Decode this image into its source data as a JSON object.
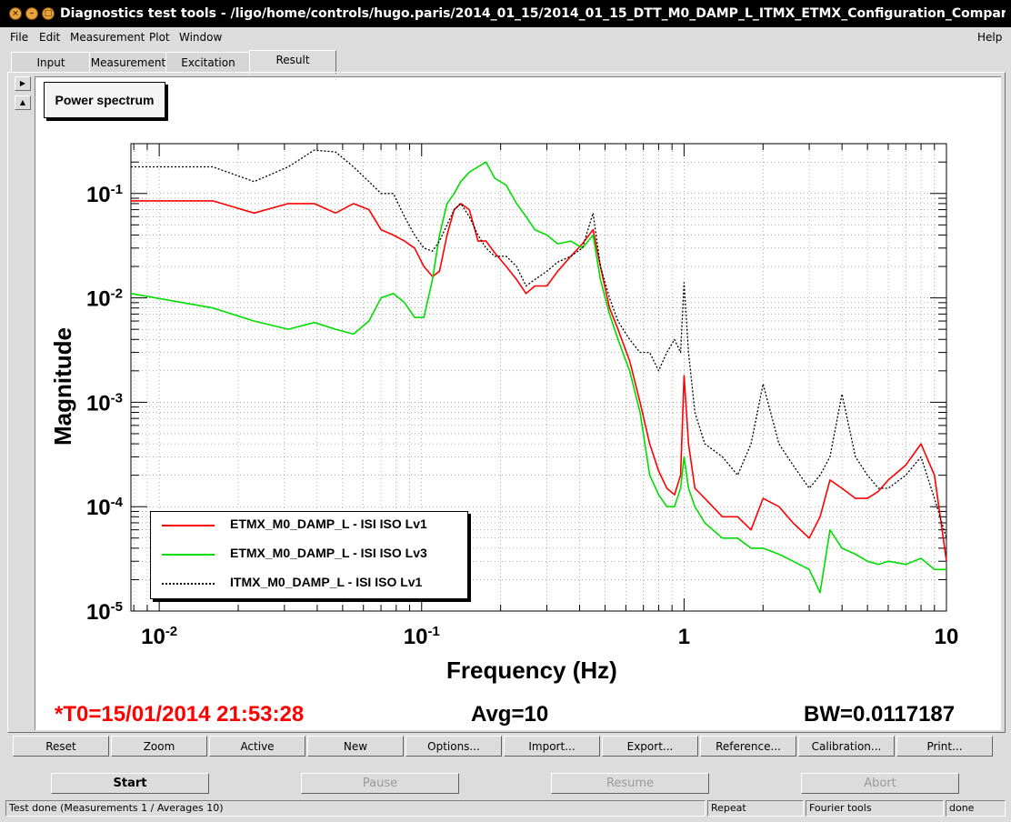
{
  "window": {
    "title": "Diagnostics test tools - /ligo/home/controls/hugo.paris/2014_01_15/2014_01_15_DTT_M0_DAMP_L_ITMX_ETMX_Configuration_Comparison_Adjus",
    "buttons": [
      "close-icon",
      "minimize-icon",
      "maximize-icon"
    ]
  },
  "menu": {
    "file": "File",
    "edit": "Edit",
    "measurement": "Measurement",
    "plot": "Plot",
    "window": "Window",
    "help": "Help"
  },
  "tabs": [
    {
      "label": "Input"
    },
    {
      "label": "Measurement"
    },
    {
      "label": "Excitation"
    },
    {
      "label": "Result"
    }
  ],
  "plot_panel": {
    "label": "Power spectrum"
  },
  "info": {
    "t0": "*T0=15/01/2014 21:53:28",
    "avg": "Avg=10",
    "bw": "BW=0.0117187"
  },
  "chart_data": {
    "type": "line",
    "xlabel": "Frequency (Hz)",
    "ylabel": "Magnitude",
    "xscale": "log",
    "yscale": "log",
    "xlim": [
      0.0078,
      10
    ],
    "ylim": [
      1e-05,
      0.3
    ],
    "x_ticks": [
      "10-2",
      "10-1",
      "1",
      "10"
    ],
    "y_ticks": [
      "10-1",
      "10-2",
      "10-3",
      "10-4",
      "10-5"
    ],
    "grid": true,
    "legend_position": "bottom-left",
    "series": [
      {
        "name": "ETMX_M0_DAMP_L - ISI ISO Lv1",
        "color": "#ff0000",
        "style": "solid",
        "points": [
          [
            0.0078,
            0.085
          ],
          [
            0.016,
            0.085
          ],
          [
            0.023,
            0.065
          ],
          [
            0.031,
            0.08
          ],
          [
            0.039,
            0.08
          ],
          [
            0.047,
            0.065
          ],
          [
            0.055,
            0.08
          ],
          [
            0.063,
            0.07
          ],
          [
            0.07,
            0.045
          ],
          [
            0.078,
            0.04
          ],
          [
            0.086,
            0.035
          ],
          [
            0.094,
            0.03
          ],
          [
            0.102,
            0.02
          ],
          [
            0.11,
            0.016
          ],
          [
            0.117,
            0.018
          ],
          [
            0.125,
            0.04
          ],
          [
            0.133,
            0.07
          ],
          [
            0.141,
            0.08
          ],
          [
            0.152,
            0.07
          ],
          [
            0.164,
            0.035
          ],
          [
            0.176,
            0.035
          ],
          [
            0.19,
            0.027
          ],
          [
            0.21,
            0.02
          ],
          [
            0.23,
            0.015
          ],
          [
            0.25,
            0.011
          ],
          [
            0.27,
            0.013
          ],
          [
            0.3,
            0.013
          ],
          [
            0.33,
            0.018
          ],
          [
            0.37,
            0.025
          ],
          [
            0.41,
            0.033
          ],
          [
            0.45,
            0.045
          ],
          [
            0.48,
            0.02
          ],
          [
            0.52,
            0.008
          ],
          [
            0.56,
            0.005
          ],
          [
            0.62,
            0.0025
          ],
          [
            0.68,
            0.001
          ],
          [
            0.74,
            0.0004
          ],
          [
            0.8,
            0.00022
          ],
          [
            0.86,
            0.00015
          ],
          [
            0.92,
            0.00013
          ],
          [
            0.97,
            0.0002
          ],
          [
            1.0,
            0.0018
          ],
          [
            1.04,
            0.0004
          ],
          [
            1.1,
            0.00015
          ],
          [
            1.2,
            0.00012
          ],
          [
            1.4,
            8e-05
          ],
          [
            1.6,
            8e-05
          ],
          [
            1.8,
            6e-05
          ],
          [
            2.0,
            0.00012
          ],
          [
            2.3,
            0.0001
          ],
          [
            2.6,
            7e-05
          ],
          [
            3.0,
            5e-05
          ],
          [
            3.3,
            8e-05
          ],
          [
            3.6,
            0.00018
          ],
          [
            4.0,
            0.00015
          ],
          [
            4.5,
            0.00012
          ],
          [
            5.0,
            0.00012
          ],
          [
            5.5,
            0.00014
          ],
          [
            6.0,
            0.00018
          ],
          [
            7.0,
            0.00025
          ],
          [
            8.0,
            0.0004
          ],
          [
            9.0,
            0.0002
          ],
          [
            10.0,
            3e-05
          ]
        ]
      },
      {
        "name": "ETMX_M0_DAMP_L - ISI ISO Lv3",
        "color": "#00dd00",
        "style": "solid",
        "points": [
          [
            0.0078,
            0.011
          ],
          [
            0.016,
            0.008
          ],
          [
            0.023,
            0.006
          ],
          [
            0.031,
            0.005
          ],
          [
            0.039,
            0.0058
          ],
          [
            0.047,
            0.005
          ],
          [
            0.055,
            0.0045
          ],
          [
            0.063,
            0.006
          ],
          [
            0.07,
            0.01
          ],
          [
            0.078,
            0.011
          ],
          [
            0.086,
            0.009
          ],
          [
            0.094,
            0.0065
          ],
          [
            0.102,
            0.0065
          ],
          [
            0.11,
            0.015
          ],
          [
            0.117,
            0.04
          ],
          [
            0.125,
            0.08
          ],
          [
            0.133,
            0.1
          ],
          [
            0.141,
            0.13
          ],
          [
            0.152,
            0.16
          ],
          [
            0.164,
            0.18
          ],
          [
            0.176,
            0.2
          ],
          [
            0.19,
            0.14
          ],
          [
            0.21,
            0.12
          ],
          [
            0.23,
            0.08
          ],
          [
            0.25,
            0.06
          ],
          [
            0.27,
            0.045
          ],
          [
            0.3,
            0.04
          ],
          [
            0.33,
            0.033
          ],
          [
            0.37,
            0.035
          ],
          [
            0.41,
            0.03
          ],
          [
            0.45,
            0.04
          ],
          [
            0.48,
            0.015
          ],
          [
            0.52,
            0.007
          ],
          [
            0.56,
            0.004
          ],
          [
            0.62,
            0.002
          ],
          [
            0.68,
            0.0008
          ],
          [
            0.74,
            0.0002
          ],
          [
            0.8,
            0.00013
          ],
          [
            0.86,
            0.0001
          ],
          [
            0.92,
            0.0001
          ],
          [
            0.97,
            0.00015
          ],
          [
            1.0,
            0.0003
          ],
          [
            1.04,
            0.00015
          ],
          [
            1.1,
            0.0001
          ],
          [
            1.2,
            7e-05
          ],
          [
            1.4,
            5e-05
          ],
          [
            1.6,
            5e-05
          ],
          [
            1.8,
            4e-05
          ],
          [
            2.0,
            4e-05
          ],
          [
            2.3,
            3.5e-05
          ],
          [
            2.6,
            3e-05
          ],
          [
            3.0,
            2.5e-05
          ],
          [
            3.3,
            1.5e-05
          ],
          [
            3.6,
            6e-05
          ],
          [
            4.0,
            4e-05
          ],
          [
            4.5,
            3.5e-05
          ],
          [
            5.0,
            3e-05
          ],
          [
            5.5,
            2.8e-05
          ],
          [
            6.0,
            3e-05
          ],
          [
            7.0,
            2.8e-05
          ],
          [
            8.0,
            3.2e-05
          ],
          [
            9.0,
            2.5e-05
          ],
          [
            10.0,
            2.5e-05
          ]
        ]
      },
      {
        "name": "ITMX_M0_DAMP_L - ISI ISO Lv1",
        "color": "#000000",
        "style": "dotted",
        "points": [
          [
            0.0078,
            0.18
          ],
          [
            0.016,
            0.18
          ],
          [
            0.023,
            0.13
          ],
          [
            0.031,
            0.18
          ],
          [
            0.039,
            0.26
          ],
          [
            0.047,
            0.25
          ],
          [
            0.055,
            0.18
          ],
          [
            0.063,
            0.13
          ],
          [
            0.07,
            0.1
          ],
          [
            0.078,
            0.1
          ],
          [
            0.086,
            0.06
          ],
          [
            0.094,
            0.04
          ],
          [
            0.102,
            0.03
          ],
          [
            0.11,
            0.028
          ],
          [
            0.117,
            0.035
          ],
          [
            0.125,
            0.05
          ],
          [
            0.133,
            0.07
          ],
          [
            0.141,
            0.08
          ],
          [
            0.152,
            0.06
          ],
          [
            0.164,
            0.04
          ],
          [
            0.176,
            0.03
          ],
          [
            0.19,
            0.025
          ],
          [
            0.21,
            0.025
          ],
          [
            0.23,
            0.02
          ],
          [
            0.25,
            0.013
          ],
          [
            0.27,
            0.015
          ],
          [
            0.3,
            0.018
          ],
          [
            0.33,
            0.022
          ],
          [
            0.37,
            0.025
          ],
          [
            0.41,
            0.03
          ],
          [
            0.45,
            0.065
          ],
          [
            0.48,
            0.02
          ],
          [
            0.52,
            0.01
          ],
          [
            0.56,
            0.006
          ],
          [
            0.62,
            0.004
          ],
          [
            0.68,
            0.003
          ],
          [
            0.74,
            0.003
          ],
          [
            0.8,
            0.002
          ],
          [
            0.86,
            0.003
          ],
          [
            0.92,
            0.004
          ],
          [
            0.97,
            0.003
          ],
          [
            1.0,
            0.014
          ],
          [
            1.04,
            0.003
          ],
          [
            1.1,
            0.0008
          ],
          [
            1.2,
            0.0004
          ],
          [
            1.4,
            0.0003
          ],
          [
            1.6,
            0.0002
          ],
          [
            1.8,
            0.0004
          ],
          [
            2.0,
            0.0015
          ],
          [
            2.3,
            0.0004
          ],
          [
            2.6,
            0.00025
          ],
          [
            3.0,
            0.00015
          ],
          [
            3.3,
            0.0002
          ],
          [
            3.6,
            0.0003
          ],
          [
            4.0,
            0.0012
          ],
          [
            4.5,
            0.0003
          ],
          [
            5.0,
            0.0002
          ],
          [
            5.5,
            0.00015
          ],
          [
            6.0,
            0.00015
          ],
          [
            7.0,
            0.0002
          ],
          [
            8.0,
            0.0003
          ],
          [
            9.0,
            0.00012
          ],
          [
            10.0,
            5e-05
          ]
        ]
      }
    ]
  },
  "toolbar": {
    "reset": "Reset",
    "zoom": "Zoom",
    "active": "Active",
    "new": "New",
    "options": "Options...",
    "import": "Import...",
    "export": "Export...",
    "reference": "Reference...",
    "calibration": "Calibration...",
    "print": "Print..."
  },
  "controls": {
    "start": "Start",
    "pause": "Pause",
    "resume": "Resume",
    "abort": "Abort"
  },
  "status": {
    "message": "Test done (Measurements 1 / Averages 10)",
    "repeat": "Repeat",
    "fourier": "Fourier tools",
    "state": "done"
  }
}
